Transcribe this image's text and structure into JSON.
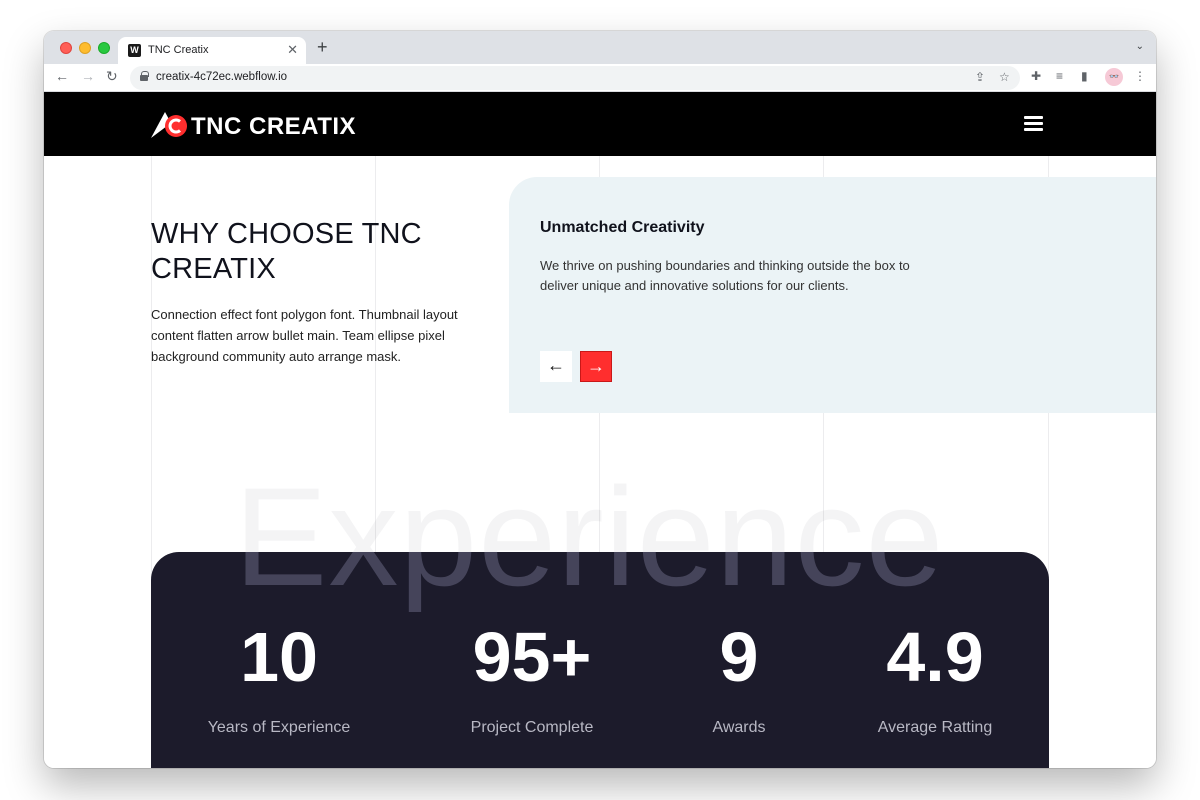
{
  "browser": {
    "tab_title": "TNC Creatix",
    "tab_favicon": "W",
    "url": "creatix-4c72ec.webflow.io"
  },
  "site": {
    "logo_text": "TNC CREATIX",
    "why": {
      "title": "WHY CHOOSE TNC CREATIX",
      "description": "Connection effect font polygon font. Thumbnail layout content flatten arrow bullet main. Team ellipse pixel background community auto arrange mask."
    },
    "feature": {
      "title": "Unmatched Creativity",
      "text": "We thrive on pushing boundaries and thinking outside the box to deliver unique and innovative solutions for our clients.",
      "prev_label": "←",
      "next_label": "→"
    },
    "background_word": "Experience",
    "stats": [
      {
        "value": "10",
        "label": "Years of Experience"
      },
      {
        "value": "95+",
        "label": "Project Complete"
      },
      {
        "value": "9",
        "label": "Awards"
      },
      {
        "value": "4.9",
        "label": "Average Ratting"
      }
    ]
  },
  "colors": {
    "accent": "#ff2e2e",
    "nav_bg": "#000000",
    "stats_bg": "#1c1b2b",
    "card_bg": "#ebf3f6"
  }
}
